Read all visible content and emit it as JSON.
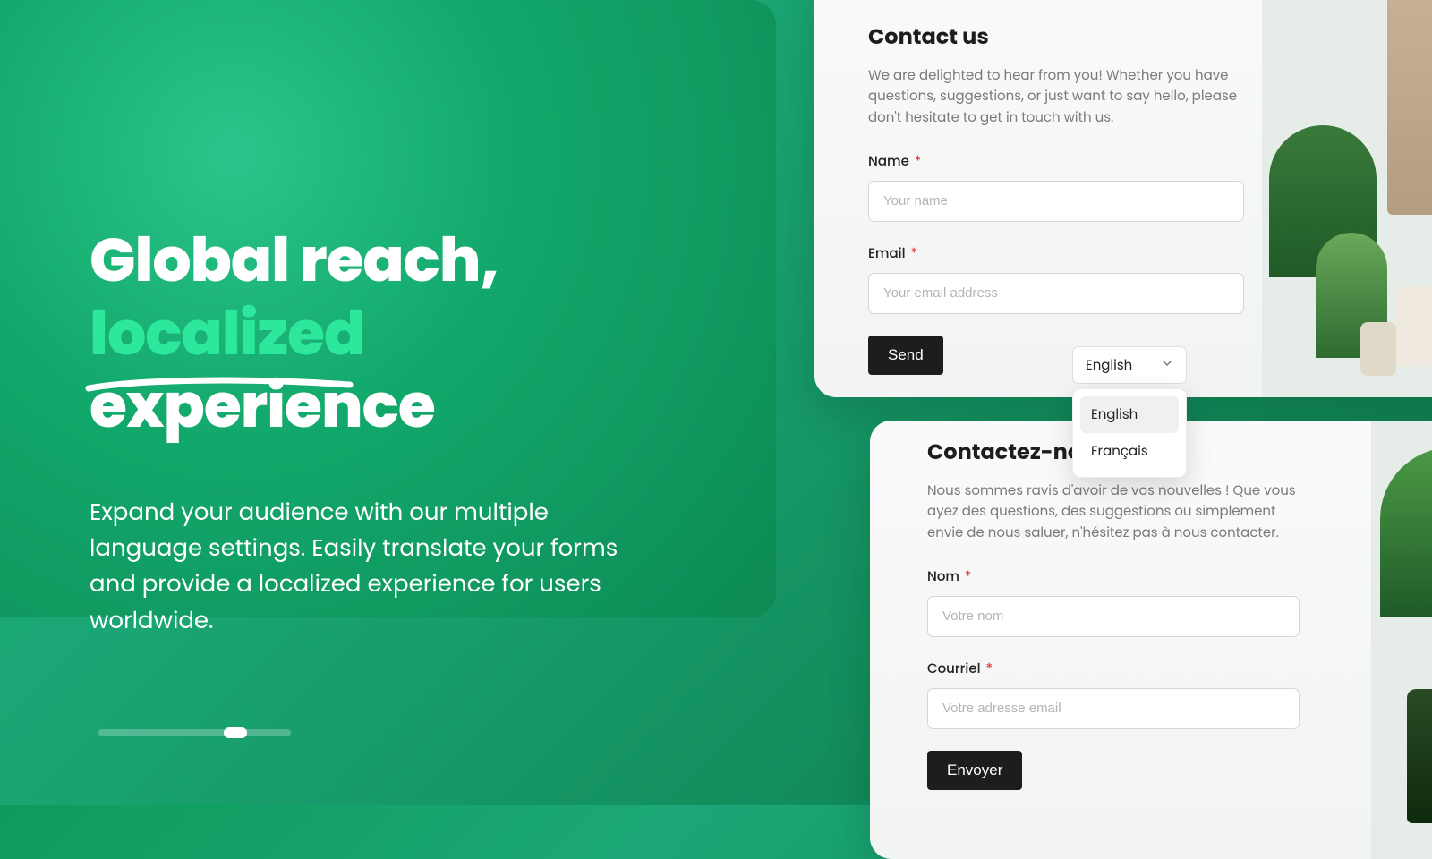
{
  "hero": {
    "title_line1": "Global reach,",
    "title_highlight": "localized",
    "title_line2_rest": " experience",
    "subtitle": "Expand your audience with our multiple language settings. Easily translate your forms and provide a localized experience for users worldwide."
  },
  "card_en": {
    "heading": "Contact us",
    "desc": "We are delighted to hear from you! Whether you have questions, suggestions, or just want to say hello, please don't hesitate to get in touch with us.",
    "name_label": "Name",
    "name_placeholder": "Your name",
    "email_label": "Email",
    "email_placeholder": "Your email address",
    "send_label": "Send"
  },
  "card_fr": {
    "heading": "Contactez-nous",
    "desc": "Nous sommes ravis d'avoir de vos nouvelles ! Que vous ayez des questions, des suggestions ou simplement envie de nous saluer, n'hésitez pas à nous contacter.",
    "name_label": "Nom",
    "name_placeholder": "Votre nom",
    "email_label": "Courriel",
    "email_placeholder": "Votre adresse email",
    "send_label": "Envoyer"
  },
  "lang": {
    "selected": "English",
    "options": [
      "English",
      "Français"
    ]
  },
  "required_marker": "*"
}
